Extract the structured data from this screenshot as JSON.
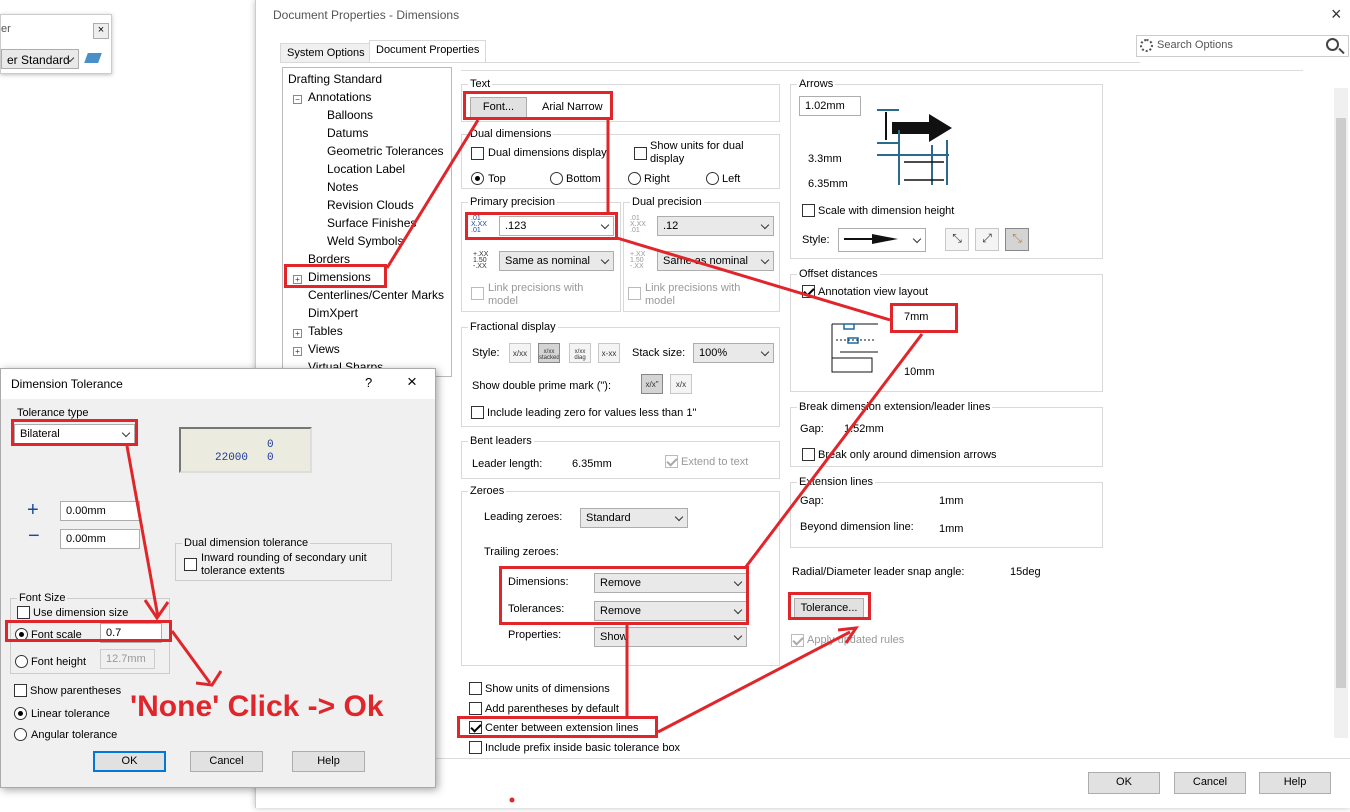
{
  "topleft": {
    "title_frag": "er",
    "standard": "er Standard"
  },
  "main": {
    "title": "Document Properties - Dimensions",
    "tabs": [
      {
        "label": "System Options"
      },
      {
        "label": "Document Properties"
      }
    ],
    "search_placeholder": "Search Options",
    "tree": [
      "Drafting Standard",
      "Annotations",
      "Balloons",
      "Datums",
      "Geometric Tolerances",
      "Location Label",
      "Notes",
      "Revision Clouds",
      "Surface Finishes",
      "Weld Symbols",
      "Borders",
      "Dimensions",
      "Centerlines/Center Marks",
      "DimXpert",
      "Tables",
      "Views",
      "Virtual Sharps"
    ],
    "text": {
      "group": "Text",
      "font_btn": "Font...",
      "font_name": "Arial Narrow"
    },
    "dual": {
      "group": "Dual dimensions",
      "display": "Dual dimensions display",
      "show_units": "Show units for dual display",
      "top": "Top",
      "bottom": "Bottom",
      "right": "Right",
      "left": "Left"
    },
    "primary": {
      "group": "Primary precision",
      "value": ".123",
      "tol": "Same as nominal",
      "link": "Link precisions with model"
    },
    "dualprec": {
      "group": "Dual precision",
      "value": ".12",
      "tol": "Same as nominal",
      "link": "Link precisions with model"
    },
    "fractional": {
      "group": "Fractional display",
      "style": "Style:",
      "stack": "Stack size:",
      "stack_value": "100%",
      "double_prime": "Show double prime mark (\"):",
      "leading_zero": "Include leading zero for values less than 1\"",
      "icons": [
        "x/xx",
        "x/xx stacked",
        "x/xx diag",
        "x-xx"
      ],
      "prime_icons": [
        "x/x\"",
        "x/x"
      ]
    },
    "bent": {
      "group": "Bent leaders",
      "length_label": "Leader length:",
      "length_value": "6.35mm",
      "extend": "Extend to text"
    },
    "zeroes": {
      "group": "Zeroes",
      "leading_label": "Leading zeroes:",
      "leading_value": "Standard",
      "trailing_label": "Trailing zeroes:",
      "dim_label": "Dimensions:",
      "dim_value": "Remove",
      "tol_label": "Tolerances:",
      "tol_value": "Remove",
      "prop_label": "Properties:",
      "prop_value": "Show"
    },
    "bottom_opts": [
      "Show units of dimensions",
      "Add parentheses by default",
      "Center between extension lines",
      "Include prefix inside basic tolerance box"
    ],
    "arrows": {
      "group": "Arrows",
      "size1": "1.02mm",
      "size2": "3.3mm",
      "size3": "6.35mm",
      "scale": "Scale with dimension height",
      "style_label": "Style:"
    },
    "offset": {
      "group": "Offset distances",
      "annotation": "Annotation view layout",
      "v1": "7mm",
      "v2": "10mm"
    },
    "break": {
      "group": "Break dimension extension/leader lines",
      "gap_label": "Gap:",
      "gap_value": "1.52mm",
      "only": "Break only around dimension arrows"
    },
    "ext": {
      "group": "Extension lines",
      "gap_label": "Gap:",
      "gap_value": "1mm",
      "beyond_label": "Beyond dimension line:",
      "beyond_value": "1mm"
    },
    "radial": {
      "label": "Radial/Diameter leader snap angle:",
      "value": "15deg"
    },
    "tolerance_btn": "Tolerance...",
    "apply_rules": "Apply updated rules",
    "buttons": {
      "ok": "OK",
      "cancel": "Cancel",
      "help": "Help"
    }
  },
  "dialog": {
    "title": "Dimension Tolerance",
    "help": "?",
    "type_label": "Tolerance type",
    "type_value": "Bilateral",
    "preview": {
      "top": "0",
      "main": "22000",
      "bottom": "0"
    },
    "plus_value": "0.00mm",
    "minus_value": "0.00mm",
    "dual_group": "Dual dimension tolerance",
    "inward": "Inward rounding of secondary unit tolerance extents",
    "font_group": "Font Size",
    "use_dim": "Use dimension size",
    "font_scale": "Font scale",
    "font_scale_value": "0.7",
    "font_height": "Font height",
    "font_height_value": "12.7mm",
    "show_paren": "Show parentheses",
    "linear": "Linear tolerance",
    "angular": "Angular tolerance",
    "buttons": {
      "ok": "OK",
      "cancel": "Cancel",
      "help": "Help"
    }
  },
  "annotation": {
    "text": "'None' Click -> Ok",
    "color": "#e0262b"
  }
}
